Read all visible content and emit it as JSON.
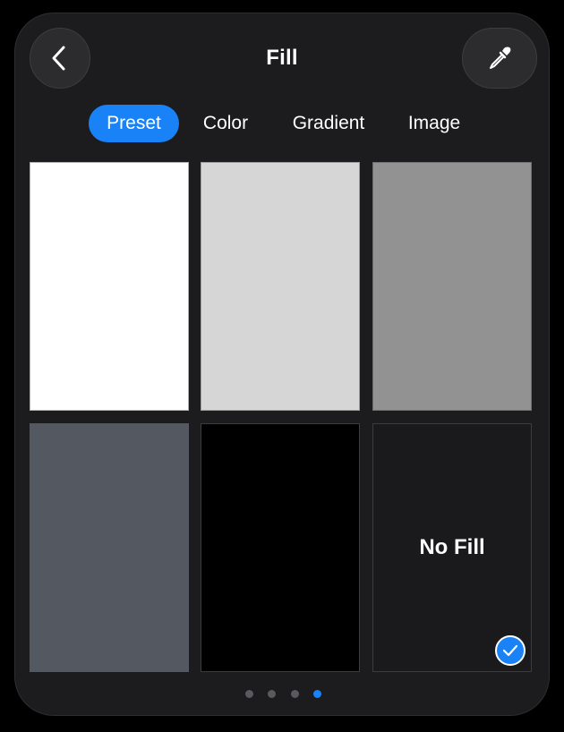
{
  "header": {
    "title": "Fill",
    "back_icon": "chevron-left-icon",
    "eyedropper_icon": "eyedropper-icon"
  },
  "tabs": [
    {
      "label": "Preset",
      "active": true
    },
    {
      "label": "Color",
      "active": false
    },
    {
      "label": "Gradient",
      "active": false
    },
    {
      "label": "Image",
      "active": false
    }
  ],
  "swatches": [
    {
      "color": "#ffffff"
    },
    {
      "color": "#d6d6d6"
    },
    {
      "color": "#929292"
    },
    {
      "color": "#545961"
    },
    {
      "color": "#000000"
    },
    {
      "label": "No Fill",
      "selected": true,
      "check_icon": "checkmark-icon"
    }
  ],
  "pagination": {
    "count": 4,
    "active_index": 3
  },
  "colors": {
    "accent": "#1a82f7",
    "panel": "#1c1c1e"
  }
}
